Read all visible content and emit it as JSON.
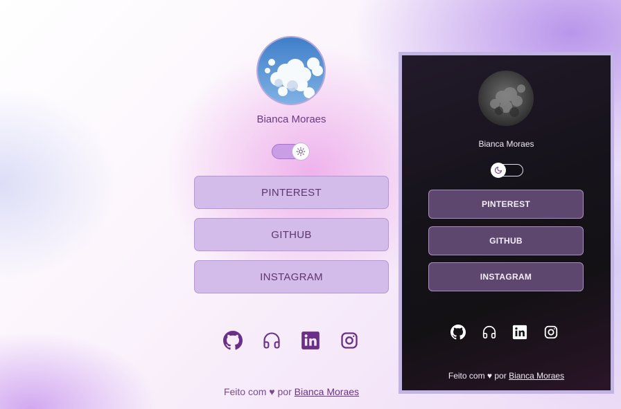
{
  "light_card": {
    "name": "Bianca Moraes",
    "theme_toggle_icon": "sun-icon",
    "buttons": [
      "PINTEREST",
      "GITHUB",
      "INSTAGRAM"
    ],
    "social_icons": [
      "github-icon",
      "headphones-icon",
      "linkedin-icon",
      "instagram-icon"
    ],
    "footer": {
      "prefix": "Feito com ♥ por",
      "author_link": "Bianca Moraes"
    }
  },
  "dark_card": {
    "name": "Bianca Moraes",
    "theme_toggle_icon": "moon-icon",
    "buttons": [
      "PINTEREST",
      "GITHUB",
      "INSTAGRAM"
    ],
    "social_icons": [
      "github-icon",
      "headphones-icon",
      "linkedin-icon",
      "instagram-icon"
    ],
    "footer": {
      "prefix": "Feito com ♥ por",
      "author_link": "Bianca Moraes"
    }
  },
  "colors": {
    "accent_purple": "#6a2f86",
    "light_button_bg": "#d4bcea",
    "dark_button_bg": "#5e476f",
    "dark_card_border": "#c3b4e6"
  }
}
